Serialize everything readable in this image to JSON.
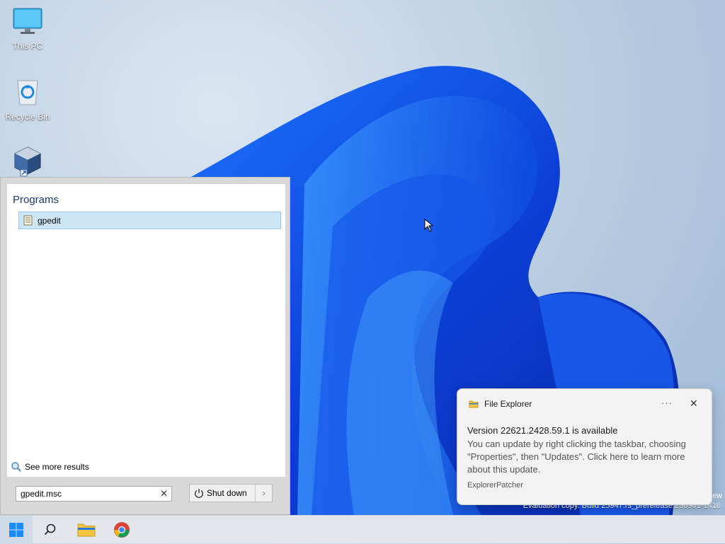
{
  "desktop": {
    "icons": [
      {
        "label": "This PC",
        "icon": "monitor-icon"
      },
      {
        "label": "Recycle Bin",
        "icon": "recycle-bin-icon"
      },
      {
        "label": "",
        "icon": "virtualbox-shortcut-icon"
      }
    ],
    "watermark_line1": "ew",
    "watermark_line2": "Evaluation copy. Build 25947.rs_prerelease.230901-1416"
  },
  "start_menu": {
    "programs_heading": "Programs",
    "results": [
      {
        "label": "gpedit",
        "icon": "gpedit-document-icon",
        "selected": true
      }
    ],
    "see_more_label": "See more results",
    "search": {
      "value": "gpedit.msc",
      "clear_icon": "close-icon"
    },
    "shutdown_label": "Shut down"
  },
  "notification": {
    "app_name": "File Explorer",
    "more_label": "···",
    "title": "Version 22621.2428.59.1 is available",
    "body": "You can update by right clicking the taskbar, choosing \"Properties\", then \"Updates\". Click here to learn more about this update.",
    "attribution": "ExplorerPatcher"
  },
  "taskbar": {
    "items": [
      "start-button",
      "search-button",
      "file-explorer-button",
      "chrome-button"
    ]
  },
  "colors": {
    "accent": "#0078d4",
    "selection": "#cde6f7",
    "folder": "#f4c542"
  }
}
